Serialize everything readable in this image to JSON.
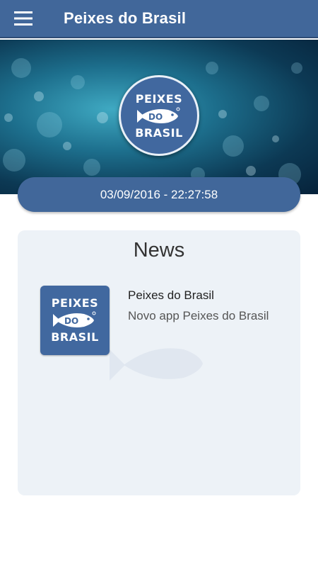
{
  "appbar": {
    "title": "Peixes do Brasil",
    "menu_icon": "hamburger-menu-icon",
    "color": "#41679a"
  },
  "hero": {
    "logo": {
      "line1": "PEIXES",
      "line2": "DO",
      "line3": "BRASIL"
    }
  },
  "datetime": "03/09/2016 - 22:27:58",
  "news": {
    "heading": "News",
    "items": [
      {
        "thumb": {
          "line1": "PEIXES",
          "line2": "DO",
          "line3": "BRASIL"
        },
        "title": "Peixes do Brasil",
        "summary": "Novo app Peixes do Brasil"
      }
    ]
  },
  "colors": {
    "primary": "#41679a",
    "card_bg": "#edf2f7"
  }
}
